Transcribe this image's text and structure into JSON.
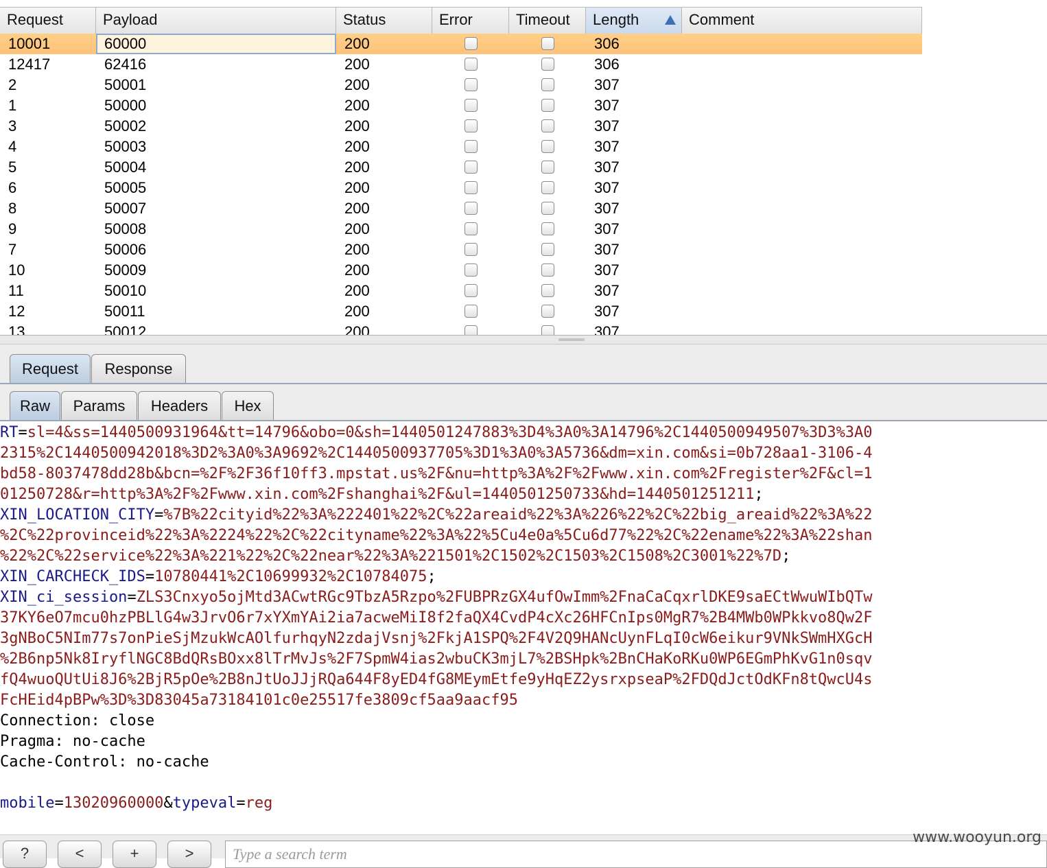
{
  "table": {
    "columns": [
      "Request",
      "Payload",
      "Status",
      "Error",
      "Timeout",
      "Length",
      "Comment"
    ],
    "sorted_column": "Length",
    "sort_direction": "ascending",
    "rows": [
      {
        "request": "10001",
        "payload": "60000",
        "status": "200",
        "error": false,
        "timeout": false,
        "length": "306",
        "selected": true
      },
      {
        "request": "12417",
        "payload": "62416",
        "status": "200",
        "error": false,
        "timeout": false,
        "length": "306"
      },
      {
        "request": "2",
        "payload": "50001",
        "status": "200",
        "error": false,
        "timeout": false,
        "length": "307"
      },
      {
        "request": "1",
        "payload": "50000",
        "status": "200",
        "error": false,
        "timeout": false,
        "length": "307"
      },
      {
        "request": "3",
        "payload": "50002",
        "status": "200",
        "error": false,
        "timeout": false,
        "length": "307"
      },
      {
        "request": "4",
        "payload": "50003",
        "status": "200",
        "error": false,
        "timeout": false,
        "length": "307"
      },
      {
        "request": "5",
        "payload": "50004",
        "status": "200",
        "error": false,
        "timeout": false,
        "length": "307"
      },
      {
        "request": "6",
        "payload": "50005",
        "status": "200",
        "error": false,
        "timeout": false,
        "length": "307"
      },
      {
        "request": "8",
        "payload": "50007",
        "status": "200",
        "error": false,
        "timeout": false,
        "length": "307"
      },
      {
        "request": "9",
        "payload": "50008",
        "status": "200",
        "error": false,
        "timeout": false,
        "length": "307"
      },
      {
        "request": "7",
        "payload": "50006",
        "status": "200",
        "error": false,
        "timeout": false,
        "length": "307"
      },
      {
        "request": "10",
        "payload": "50009",
        "status": "200",
        "error": false,
        "timeout": false,
        "length": "307"
      },
      {
        "request": "11",
        "payload": "50010",
        "status": "200",
        "error": false,
        "timeout": false,
        "length": "307"
      },
      {
        "request": "12",
        "payload": "50011",
        "status": "200",
        "error": false,
        "timeout": false,
        "length": "307"
      },
      {
        "request": "13",
        "payload": "50012",
        "status": "200",
        "error": false,
        "timeout": false,
        "length": "307"
      }
    ]
  },
  "message_tabs": [
    "Request",
    "Response"
  ],
  "active_message_tab": "Request",
  "view_tabs": [
    "Raw",
    "Params",
    "Headers",
    "Hex"
  ],
  "active_view_tab": "Raw",
  "raw_lines": [
    [
      {
        "t": "RT",
        "c": "k"
      },
      {
        "t": "=",
        "c": "p"
      },
      {
        "t": "sl=4&ss=1440500931964&tt=14796&obo=0&sh=1440501247883%3D4%3A0%3A14796%2C1440500949507%3D3%3A0",
        "c": "v"
      }
    ],
    [
      {
        "t": "2315%2C1440500942018%3D2%3A0%3A9692%2C1440500937705%3D1%3A0%3A5736&dm=xin.com&si=0b728aa1-3106-4",
        "c": "v"
      }
    ],
    [
      {
        "t": "bd58-8037478dd28b&bcn=%2F%2F36f10ff3.mpstat.us%2F&nu=http%3A%2F%2Fwww.xin.com%2Fregister%2F&cl=1",
        "c": "v"
      }
    ],
    [
      {
        "t": "01250728&r=http%3A%2F%2Fwww.xin.com%2Fshanghai%2F&ul=1440501250733&hd=1440501251211",
        "c": "v"
      },
      {
        "t": ";",
        "c": "p"
      }
    ],
    [
      {
        "t": "XIN_LOCATION_CITY",
        "c": "k"
      },
      {
        "t": "=",
        "c": "p"
      },
      {
        "t": "%7B%22cityid%22%3A%222401%22%2C%22areaid%22%3A%226%22%2C%22big_areaid%22%3A%22",
        "c": "v"
      }
    ],
    [
      {
        "t": "%2C%22provinceid%22%3A%2224%22%2C%22cityname%22%3A%22%5Cu4e0a%5Cu6d77%22%2C%22ename%22%3A%22shan",
        "c": "v"
      }
    ],
    [
      {
        "t": "%22%2C%22service%22%3A%221%22%2C%22near%22%3A%221501%2C1502%2C1503%2C1508%2C3001%22%7D",
        "c": "v"
      },
      {
        "t": ";",
        "c": "p"
      }
    ],
    [
      {
        "t": "XIN_CARCHECK_IDS",
        "c": "k"
      },
      {
        "t": "=",
        "c": "p"
      },
      {
        "t": "10780441%2C10699932%2C10784075",
        "c": "v"
      },
      {
        "t": ";",
        "c": "p"
      }
    ],
    [
      {
        "t": "XIN_ci_session",
        "c": "k"
      },
      {
        "t": "=",
        "c": "p"
      },
      {
        "t": "ZLS3Cnxyo5ojMtd3ACwtRGc9TbzA5Rzpo%2FUBPRzGX4ufOwImm%2FnaCaCqxrlDKE9saECtWwuWIbQTw",
        "c": "v"
      }
    ],
    [
      {
        "t": "37KY6eO7mcu0hzPBLlG4w3JrvO6r7xYXmYAi2ia7acweMiI8f2faQX4CvdP4cXc26HFCnIps0MgR7%2B4MWb0WPkkvo8Qw2F",
        "c": "v"
      }
    ],
    [
      {
        "t": "3gNBoC5NIm77s7onPieSjMzukWcAOlfurhqyN2zdajVsnj%2FkjA1SPQ%2F4V2Q9HANcUynFLqI0cW6eikur9VNkSWmHXGcH",
        "c": "v"
      }
    ],
    [
      {
        "t": "%2B6np5Nk8IryflNGC8BdQRsBOxx8lTrMvJs%2F7SpmW4ias2wbuCK3mjL7%2BSHpk%2BnCHaKoRKu0WP6EGmPhKvG1n0sqv",
        "c": "v"
      }
    ],
    [
      {
        "t": "fQ4wuoQUtUi8J6%2BjR5pOe%2B8nJtUoJJjRQa644F8yED4fG8MEymEtfe9yHqEZ2ysrxpseaP%2FDQdJctOdKFn8tQwcU4s",
        "c": "v"
      }
    ],
    [
      {
        "t": "FcHEid4pBPw%3D%3D83045a73184101c0e25517fe3809cf5aa9aacf95",
        "c": "v"
      }
    ],
    [
      {
        "t": "Connection: close",
        "c": "h"
      }
    ],
    [
      {
        "t": "Pragma: no-cache",
        "c": "h"
      }
    ],
    [
      {
        "t": "Cache-Control: no-cache",
        "c": "h"
      }
    ],
    [],
    [
      {
        "t": "mobile",
        "c": "k"
      },
      {
        "t": "=",
        "c": "p"
      },
      {
        "t": "13020960000",
        "c": "v"
      },
      {
        "t": "&",
        "c": "p"
      },
      {
        "t": "typeval",
        "c": "k"
      },
      {
        "t": "=",
        "c": "p"
      },
      {
        "t": "reg",
        "c": "v"
      }
    ]
  ],
  "bottom_bar": {
    "help_label": "?",
    "prev_label": "<",
    "add_label": "+",
    "next_label": ">",
    "search_placeholder": "Type a search term"
  },
  "watermark": "www.wooyun.org"
}
